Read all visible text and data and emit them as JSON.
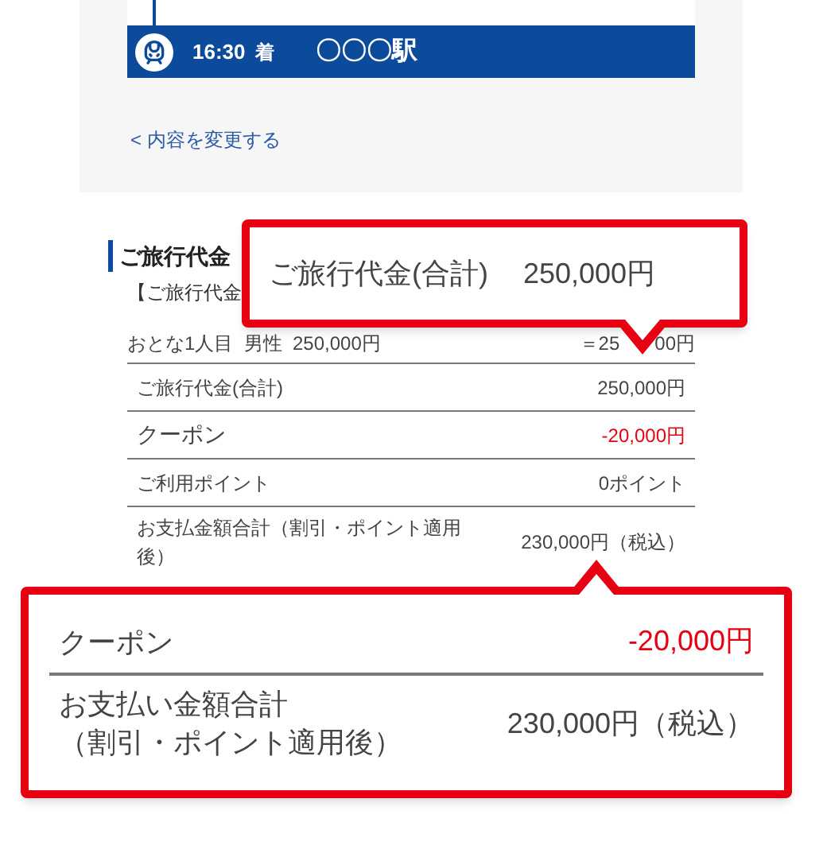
{
  "route": {
    "arrival_time": "16:30",
    "arrival_suffix": "着",
    "station": "〇〇〇駅"
  },
  "change_link": "< 内容を変更する",
  "section": {
    "title": "ご旅行代金",
    "subtitle": "【ご旅行代金"
  },
  "passenger_row": {
    "label": "おとな1人目  男性  250,000円",
    "value_parts": [
      "＝25",
      "00円"
    ]
  },
  "rows": [
    {
      "kind": "normal",
      "label": "ご旅行代金(合計)",
      "value": "250,000円"
    },
    {
      "kind": "discount",
      "label": "クーポン",
      "value": "-20,000円"
    },
    {
      "kind": "normal",
      "label": "ご利用ポイント",
      "value": "0ポイント"
    },
    {
      "kind": "normal",
      "label": "お支払金額合計（割引・ポイント適用後）",
      "value": "230,000円（税込）"
    }
  ],
  "callout_total": {
    "label": "ご旅行代金(合計)",
    "value": "250,000円"
  },
  "callout_summary": {
    "rows": [
      {
        "kind": "discount",
        "label_lines": [
          "クーポン"
        ],
        "value": "-20,000円"
      },
      {
        "kind": "normal",
        "label_lines": [
          "お支払い金額合計",
          "（割引・ポイント適用後）"
        ],
        "value": "230,000円（税込）"
      }
    ]
  }
}
